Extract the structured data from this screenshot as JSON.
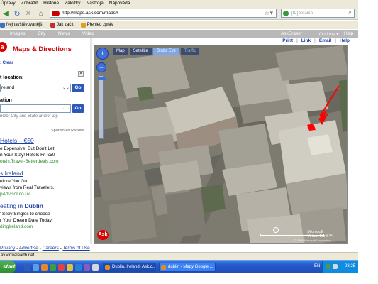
{
  "menu": [
    "Úpravy",
    "Zobrazit",
    "Historie",
    "Záložky",
    "Nástroje",
    "Nápověda"
  ],
  "url": "http://maps.ask.com/maps#",
  "search_placeholder": "[IC] Search",
  "bookmarks": [
    {
      "label": "Nejnavštěvovanější",
      "color": "#3d6fc8"
    },
    {
      "label": "Jak začít",
      "color": "#c03030"
    },
    {
      "label": "Přehled zpráv",
      "color": "#e0a020"
    }
  ],
  "ask_nav": {
    "items": [
      "Images",
      "City",
      "News",
      "Video"
    ],
    "ask_eraser": "AskEraser",
    "options": "Options ▾",
    "help": "Help"
  },
  "left": {
    "title": "Maps & Directions",
    "clear": ": Clear",
    "start_label": "t location:",
    "start_value": "reland",
    "dest_label": "ation",
    "dest_value": "",
    "hint": "nd/or City and State and/or Zip",
    "go": "Go",
    "close": "×",
    "sponsored": "Sponsored Results"
  },
  "ads": [
    {
      "title": "Hotels – €50",
      "line1": "e Expensive, But Don't Let",
      "line2": "n Your Stay! Hotels Fr. €50",
      "url": "otels.Travel-Betterdeals.com"
    },
    {
      "title": "s Ireland",
      "line1": "efore You Go.",
      "line2": "views from Real Travelers.",
      "url": "pAdvisor.co.uk"
    },
    {
      "title_a": "eating in ",
      "title_b": "Dublin",
      "line1": "' Sexy Singles to choose",
      "line2": "r Your Dream Date Today!",
      "url": "dingIreland.com"
    }
  ],
  "map_links": [
    "Print",
    "Link",
    "Email",
    "Help"
  ],
  "map": {
    "tabs": [
      "Map",
      "Satellite",
      "Bird's Eye",
      "Traffic"
    ],
    "active_tab": "Bird's Eye",
    "zoom_in": "+",
    "zoom_out": "−",
    "logo": "Ask",
    "ve_line1": "Microsoft",
    "ve_line2": "Virtual Earth™",
    "copyright": "© 2008 Microsoft Corporation"
  },
  "footer": [
    "Privacy",
    "Advertise",
    "Careers",
    "Terms of Use"
  ],
  "status": "ev.virtualearth.net",
  "taskbar": {
    "start": "start",
    "tasks": [
      {
        "label": "Dublin, Ireland- Ask.c...",
        "active": true
      },
      {
        "label": "dublin - Mapy Google ...",
        "active": false
      }
    ],
    "lang": "EN",
    "clock": "23:25"
  }
}
